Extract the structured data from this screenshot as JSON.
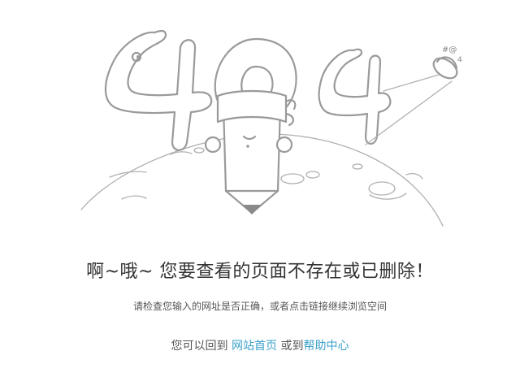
{
  "illustration": {
    "ufo_symbols": "#@",
    "ufo_symbol2": "4"
  },
  "message": {
    "headline": "啊~哦~ 您要查看的页面不存在或已删除！",
    "subline": "请检查您输入的网址是否正确，或者点击链接继续浏览空间"
  },
  "links": {
    "prefix": "您可以回到",
    "home_label": "网站首页",
    "middle": "或到",
    "help_label": "帮助中心"
  }
}
